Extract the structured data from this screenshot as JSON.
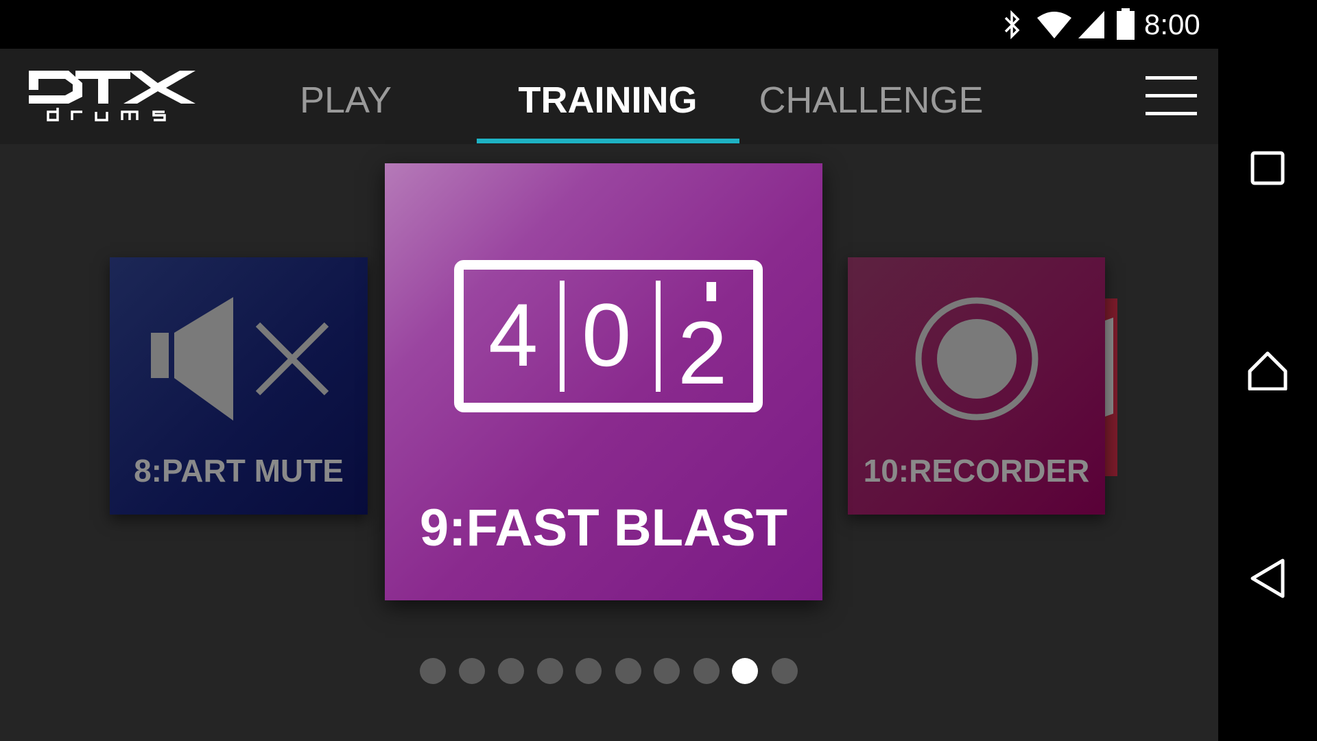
{
  "status_bar": {
    "time": "8:00",
    "icons": [
      "bluetooth-icon",
      "wifi-icon",
      "signal-icon",
      "battery-icon"
    ]
  },
  "header": {
    "logo_text": "DTX drums",
    "tabs": [
      {
        "label": "PLAY",
        "active": false
      },
      {
        "label": "TRAINING",
        "active": true
      },
      {
        "label": "CHALLENGE",
        "active": false
      }
    ],
    "menu_icon": "hamburger-menu-icon",
    "accent_color": "#1fb3c4"
  },
  "carousel": {
    "cards": [
      {
        "label": "8:PART MUTE",
        "icon": "speaker-mute-icon"
      },
      {
        "label": "9:FAST BLAST",
        "icon": "tempo-counter-icon",
        "counter_digits": [
          "4",
          "0",
          "2"
        ]
      },
      {
        "label": "10:RECORDER",
        "icon": "record-icon"
      }
    ],
    "page_count": 10,
    "current_page": 9
  },
  "nav_bar": {
    "icons": [
      "recents-square-icon",
      "home-icon",
      "back-icon"
    ]
  }
}
